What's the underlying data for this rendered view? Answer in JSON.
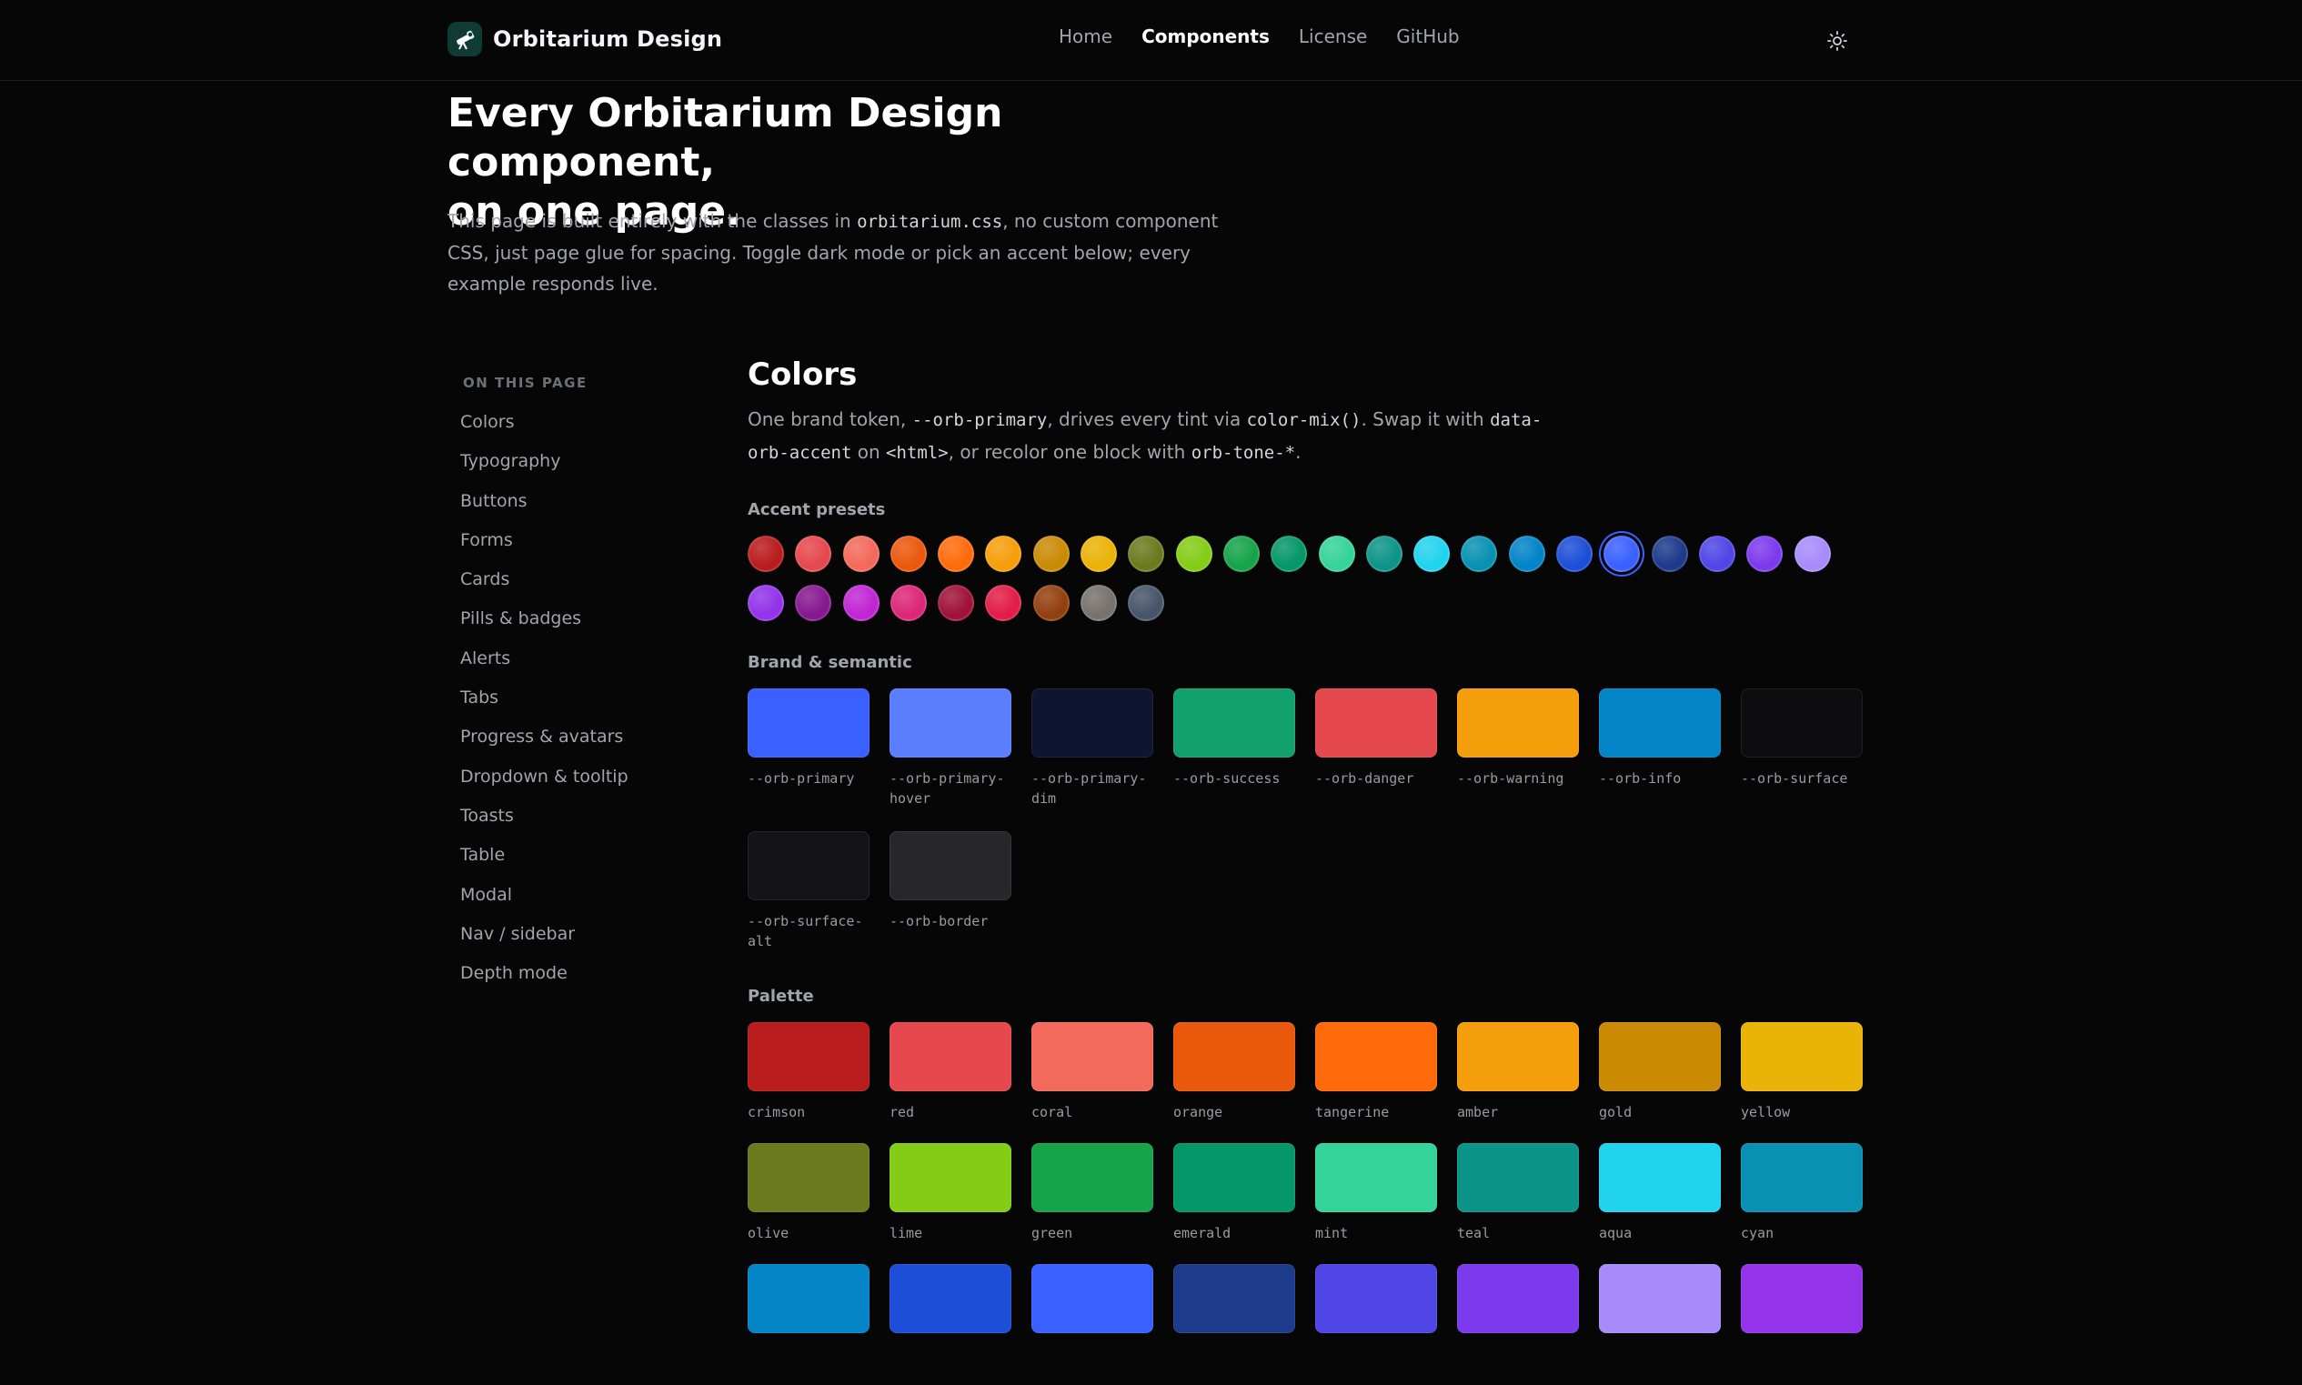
{
  "brand": {
    "name": "Orbitarium Design",
    "logo_icon": "telescope-icon"
  },
  "nav": {
    "items": [
      {
        "label": "Home",
        "active": false
      },
      {
        "label": "Components",
        "active": true
      },
      {
        "label": "License",
        "active": false
      },
      {
        "label": "GitHub",
        "active": false
      }
    ],
    "theme_toggle_icon": "sun-icon"
  },
  "hero": {
    "title_line1": "Every Orbitarium Design component,",
    "title_line2": "on one page.",
    "desc_before": "This page is built entirely with the classes in ",
    "desc_code": "orbitarium.css",
    "desc_after": ", no custom component CSS, just page glue for spacing. Toggle dark mode or pick an accent below; every example responds live."
  },
  "toc": {
    "heading": "ON THIS PAGE",
    "items": [
      "Colors",
      "Typography",
      "Buttons",
      "Forms",
      "Cards",
      "Pills & badges",
      "Alerts",
      "Tabs",
      "Progress & avatars",
      "Dropdown & tooltip",
      "Toasts",
      "Table",
      "Modal",
      "Nav / sidebar",
      "Depth mode"
    ]
  },
  "colors": {
    "title": "Colors",
    "desc_1": "One brand token, ",
    "desc_code1": "--orb-primary",
    "desc_2": ", drives every tint via ",
    "desc_code2": "color-mix()",
    "desc_3": ". Swap it with ",
    "desc_code3": "data-orb-accent",
    "desc_4": " on ",
    "desc_code4": "<html>",
    "desc_5": ", or recolor one block with ",
    "desc_code5": "orb-tone-*",
    "desc_6": ".",
    "presets_label": "Accent presets",
    "presets": [
      "#b91c1c",
      "#e5484d",
      "#f36a5c",
      "#ea580c",
      "#ff6b0a",
      "#f59e0b",
      "#ca8a04",
      "#eab308",
      "#6b7a1d",
      "#84cc16",
      "#16a34a",
      "#059669",
      "#34d399",
      "#0d9488",
      "#22d3ee",
      "#0891b2",
      "#0284c7",
      "#1d4ed8",
      "#3a61ff",
      "#1e3a8a",
      "#4f46e5",
      "#7c3aed",
      "#a78bfa",
      "#9333ea",
      "#86198f",
      "#c026d3",
      "#db2777",
      "#9f1239",
      "#e11d48",
      "#92400e",
      "#78716c",
      "#475569"
    ],
    "selected_preset": 18,
    "brand_label": "Brand & semantic",
    "brand": [
      {
        "name": "--orb-primary",
        "color": "#3a61ff"
      },
      {
        "name": "--orb-primary-hover",
        "color": "#5b7dff"
      },
      {
        "name": "--orb-primary-dim",
        "color": "#0d1530"
      },
      {
        "name": "--orb-success",
        "color": "#12a06f"
      },
      {
        "name": "--orb-danger",
        "color": "#e5484d"
      },
      {
        "name": "--orb-warning",
        "color": "#f59e0b"
      },
      {
        "name": "--orb-info",
        "color": "#0284c7"
      },
      {
        "name": "--orb-surface",
        "color": "#0d0d10"
      },
      {
        "name": "--orb-surface-alt",
        "color": "#141418"
      },
      {
        "name": "--orb-border",
        "color": "#26262b"
      }
    ],
    "palette_label": "Palette",
    "palette": [
      {
        "name": "crimson",
        "color": "#b91c1c"
      },
      {
        "name": "red",
        "color": "#e5484d"
      },
      {
        "name": "coral",
        "color": "#f36a5c"
      },
      {
        "name": "orange",
        "color": "#ea580c"
      },
      {
        "name": "tangerine",
        "color": "#ff6b0a"
      },
      {
        "name": "amber",
        "color": "#f59e0b"
      },
      {
        "name": "gold",
        "color": "#ca8a04"
      },
      {
        "name": "yellow",
        "color": "#eab308"
      },
      {
        "name": "olive",
        "color": "#6b7a1d"
      },
      {
        "name": "lime",
        "color": "#84cc16"
      },
      {
        "name": "green",
        "color": "#16a34a"
      },
      {
        "name": "emerald",
        "color": "#059669"
      },
      {
        "name": "mint",
        "color": "#34d399"
      },
      {
        "name": "teal",
        "color": "#0d9488"
      },
      {
        "name": "aqua",
        "color": "#22d3ee"
      },
      {
        "name": "cyan",
        "color": "#0891b2"
      },
      {
        "color": "#0284c7"
      },
      {
        "color": "#1d4ed8"
      },
      {
        "color": "#3a61ff"
      },
      {
        "color": "#1e3a8a"
      },
      {
        "color": "#4f46e5"
      },
      {
        "color": "#7c3aed"
      },
      {
        "color": "#a78bfa"
      },
      {
        "color": "#9333ea"
      }
    ]
  }
}
